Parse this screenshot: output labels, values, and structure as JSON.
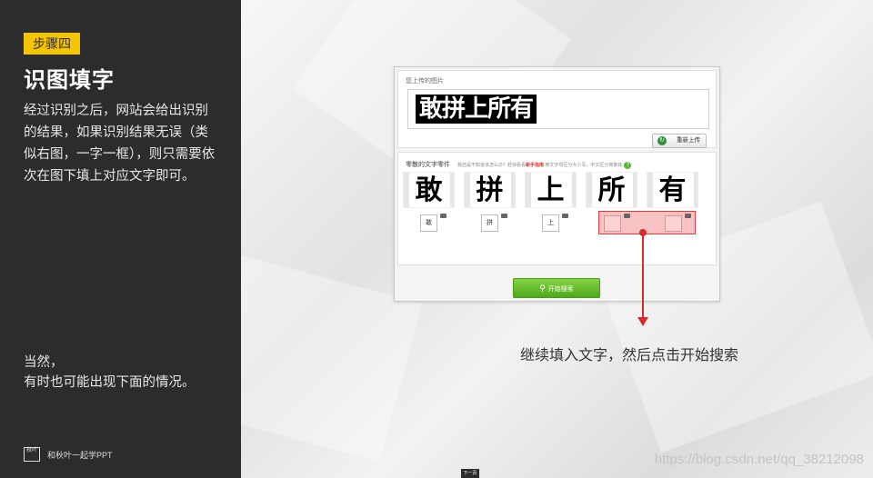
{
  "left_panel": {
    "step_badge": "步骤四",
    "title": "识图填字",
    "description": "经过识别之后，网站会给出识别的结果，如果识别结果无误（类似右图，一字一框），则只需要依次在图下填上对应文字即可。",
    "note_line1": "当然，",
    "note_line2": "有时也可能出现下面的情况。",
    "brand_logo": "秋叶",
    "brand_text": "和秋叶一起学PPT"
  },
  "window": {
    "uploaded_label": "您上传的图片",
    "uploaded_image_text": "敢拼上所有",
    "reupload_label": "重新上传",
    "parts_label": "零散的文字零件",
    "hint_prefix": "我还是不知道该怎么办？赶快看看",
    "hint_link": "新手指南",
    "hint_suffix": "英文字母区分大小写，中文区分简繁体",
    "characters": [
      "敢",
      "拼",
      "上",
      "所",
      "有"
    ],
    "inputs": [
      "敢",
      "拼",
      "上",
      "",
      ""
    ],
    "search_button": "开始搜索"
  },
  "annotation": "继续填入文字，然后点击开始搜索",
  "watermark": "https://blog.csdn.net/qq_38212098",
  "next_button": "下一页",
  "colors": {
    "accent": "#f5c400",
    "dark_panel": "#2c2c2c",
    "arrow": "#d62b2b",
    "button_green": "#5fb52a"
  }
}
